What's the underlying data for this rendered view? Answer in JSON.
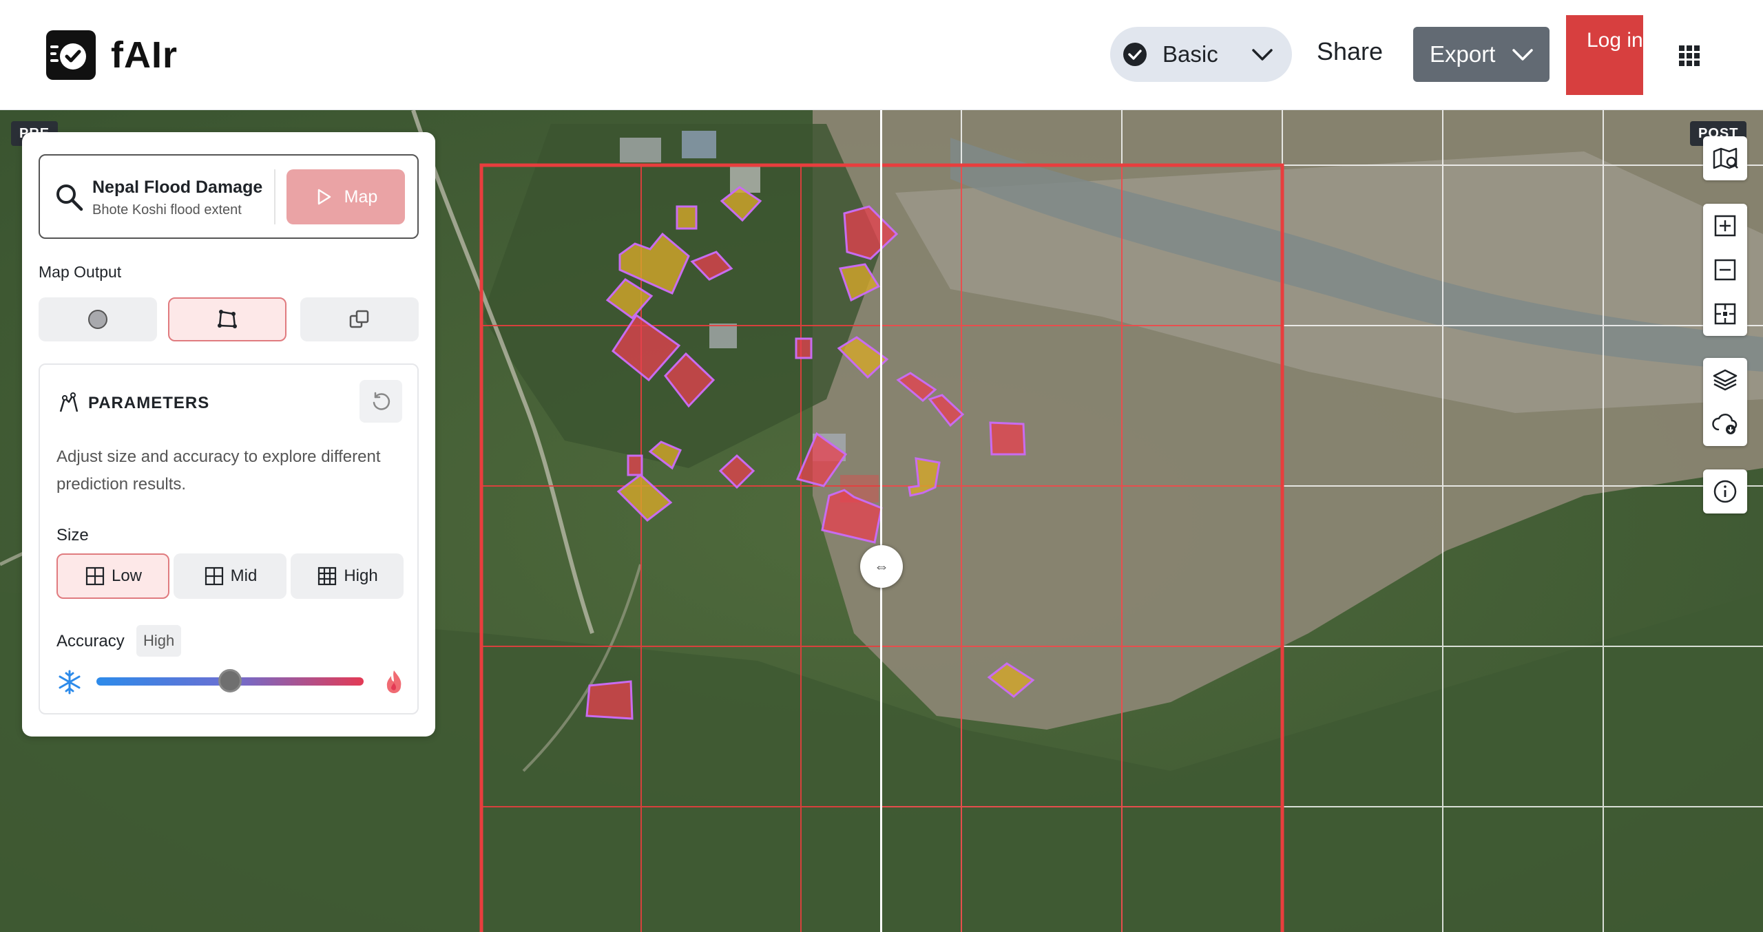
{
  "header": {
    "app_name": "fAIr",
    "mode_label": "Basic",
    "share_label": "Share",
    "export_label": "Export",
    "login_label": "Log in"
  },
  "map": {
    "pre_label": "PRE",
    "post_label": "POST",
    "swipe_glyph": "⇔"
  },
  "panel": {
    "search_title": "Nepal Flood Damage",
    "search_subtitle": "Bhote Koshi flood extent",
    "map_button_label": "Map",
    "map_output_label": "Map Output",
    "parameters_title": "PARAMETERS",
    "parameters_description": "Adjust size and accuracy to explore different prediction results.",
    "size_label": "Size",
    "size_options": [
      "Low",
      "Mid",
      "High"
    ],
    "size_selected": "Low",
    "accuracy_label": "Accuracy",
    "accuracy_value": "High",
    "accuracy_slider_fraction": 0.5
  },
  "icons": {
    "map_output": [
      "circle-icon",
      "polygon-icon",
      "overlap-icon"
    ],
    "map_controls": [
      "map-search-icon",
      "zoom-in-icon",
      "zoom-out-icon",
      "fit-bounds-icon",
      "layers-icon",
      "download-icon",
      "info-icon"
    ]
  },
  "colors": {
    "accent_red": "#d73f3f",
    "prediction_red": "#e8404f",
    "prediction_yellow": "#d4a82a",
    "prediction_outline": "#c86cf0",
    "grid_red": "#e83e3e"
  }
}
